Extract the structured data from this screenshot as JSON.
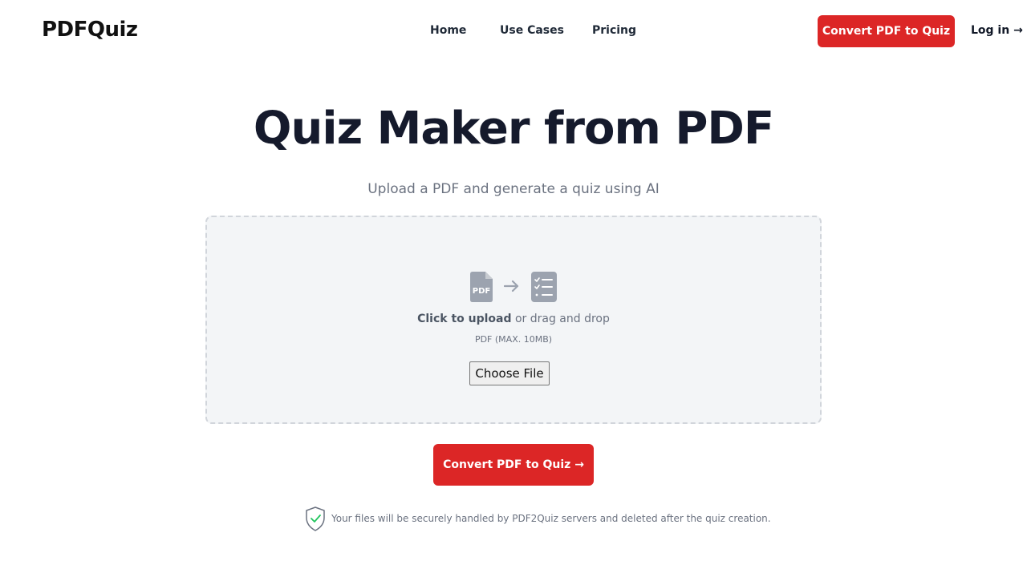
{
  "header": {
    "logo": "PDFQuiz",
    "nav": [
      {
        "label": "Home"
      },
      {
        "label": "Use Cases"
      },
      {
        "label": "Pricing"
      }
    ],
    "cta_label": "Convert PDF to Quiz",
    "login_label": "Log in →"
  },
  "hero": {
    "title": "Quiz Maker from PDF",
    "subtitle": "Upload a PDF and generate a quiz using AI"
  },
  "dropzone": {
    "icons": [
      "pdf-file-icon",
      "arrow-right-icon",
      "checklist-icon"
    ],
    "click_text": "Click to upload",
    "drag_text": " or drag and drop",
    "hint": "PDF (MAX. 10MB)",
    "choose_file_label": "Choose File"
  },
  "main_cta_label": "Convert PDF to Quiz →",
  "security": {
    "icon": "shield-check-icon",
    "text": "Your files will be securely handled by PDF2Quiz servers and deleted after the quiz creation."
  },
  "colors": {
    "accent": "#dc2626",
    "title": "#151a2c",
    "muted": "#6b7280",
    "dropzone_bg": "#f3f5f7",
    "icon_gray": "#9ca3af",
    "check_green": "#22c55e"
  }
}
